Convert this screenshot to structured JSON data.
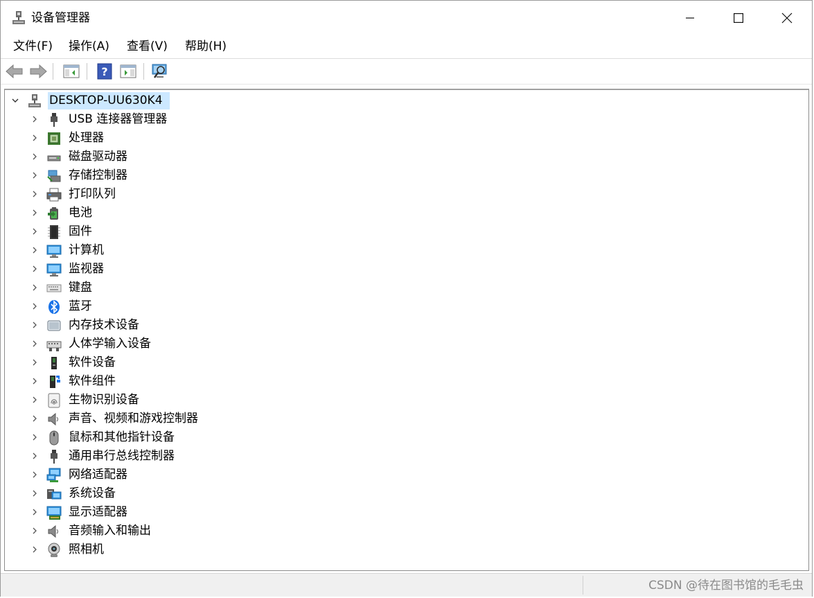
{
  "window": {
    "title": "设备管理器"
  },
  "menu": {
    "items": [
      "文件(F)",
      "操作(A)",
      "查看(V)",
      "帮助(H)"
    ]
  },
  "tree": {
    "root": "DESKTOP-UU630K4",
    "items": [
      {
        "label": "USB 连接器管理器",
        "icon": "usb-plug-icon"
      },
      {
        "label": "处理器",
        "icon": "cpu-chip-icon"
      },
      {
        "label": "磁盘驱动器",
        "icon": "disk-drive-icon"
      },
      {
        "label": "存储控制器",
        "icon": "storage-controller-icon"
      },
      {
        "label": "打印队列",
        "icon": "printer-icon"
      },
      {
        "label": "电池",
        "icon": "battery-icon"
      },
      {
        "label": "固件",
        "icon": "firmware-chip-icon"
      },
      {
        "label": "计算机",
        "icon": "computer-monitor-icon"
      },
      {
        "label": "监视器",
        "icon": "monitor-icon"
      },
      {
        "label": "键盘",
        "icon": "keyboard-icon"
      },
      {
        "label": "蓝牙",
        "icon": "bluetooth-icon"
      },
      {
        "label": "内存技术设备",
        "icon": "memory-device-icon"
      },
      {
        "label": "人体学输入设备",
        "icon": "hid-icon"
      },
      {
        "label": "软件设备",
        "icon": "software-device-icon"
      },
      {
        "label": "软件组件",
        "icon": "software-component-icon"
      },
      {
        "label": "生物识别设备",
        "icon": "fingerprint-icon"
      },
      {
        "label": "声音、视频和游戏控制器",
        "icon": "speaker-icon"
      },
      {
        "label": "鼠标和其他指针设备",
        "icon": "mouse-icon"
      },
      {
        "label": "通用串行总线控制器",
        "icon": "usb-plug-icon"
      },
      {
        "label": "网络适配器",
        "icon": "network-adapter-icon"
      },
      {
        "label": "系统设备",
        "icon": "system-device-icon"
      },
      {
        "label": "显示适配器",
        "icon": "display-adapter-icon"
      },
      {
        "label": "音频输入和输出",
        "icon": "speaker-icon"
      },
      {
        "label": "照相机",
        "icon": "webcam-icon"
      }
    ]
  },
  "status": {
    "watermark": "CSDN @待在图书馆的毛毛虫"
  },
  "colors": {
    "selection": "#cce8ff",
    "accent": "#0078d7"
  }
}
